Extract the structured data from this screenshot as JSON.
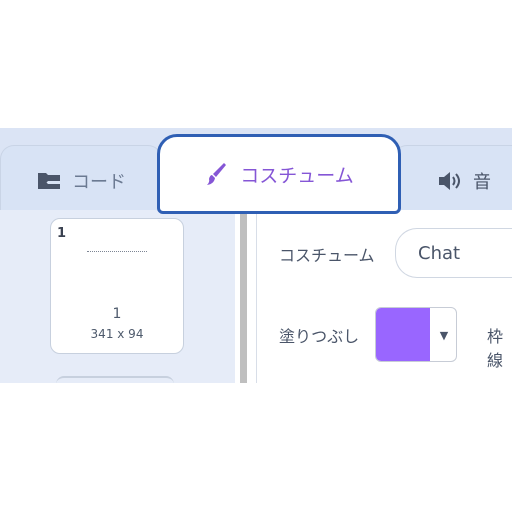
{
  "colors": {
    "accent": "#8556d6",
    "active_border": "#2f5fb4",
    "fill": "#9966ff"
  },
  "tabs": {
    "code": {
      "label": "コード",
      "icon": "code-blocks-icon"
    },
    "costumes": {
      "label": "コスチューム",
      "icon": "paintbrush-icon"
    },
    "sounds": {
      "label": "音",
      "icon": "speaker-icon"
    }
  },
  "costume_list": {
    "items": [
      {
        "index": "1",
        "name": "1",
        "size": "341 x 94"
      }
    ]
  },
  "editor": {
    "costume_label": "コスチューム",
    "costume_name": "Chat",
    "fill_label": "塗りつぶし",
    "outline_label": "枠線"
  }
}
